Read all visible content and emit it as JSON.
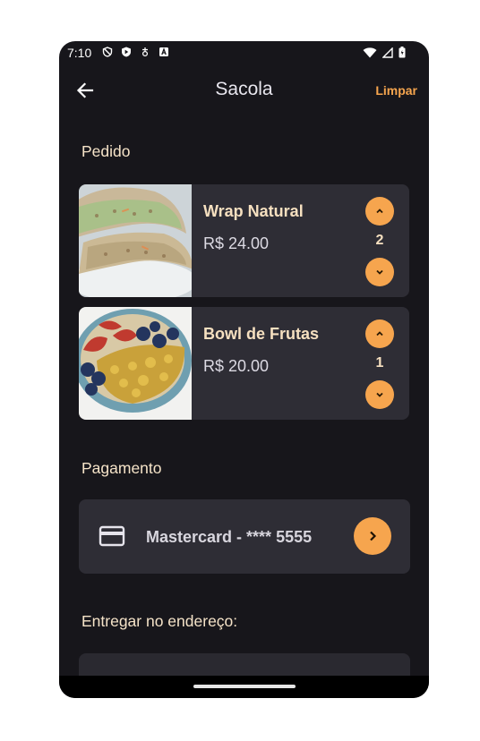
{
  "status": {
    "time": "7:10"
  },
  "header": {
    "title": "Sacola",
    "clear_label": "Limpar"
  },
  "order": {
    "section_label": "Pedido",
    "items": [
      {
        "name": "Wrap Natural",
        "price": "R$ 24.00",
        "quantity": "2"
      },
      {
        "name": "Bowl de Frutas",
        "price": "R$ 20.00",
        "quantity": "1"
      }
    ]
  },
  "payment": {
    "section_label": "Pagamento",
    "method": "Mastercard - **** 5555"
  },
  "delivery": {
    "section_label": "Entregar no endereço:"
  },
  "colors": {
    "accent": "#f6a54e",
    "background": "#17161b",
    "card": "#2e2d35"
  }
}
